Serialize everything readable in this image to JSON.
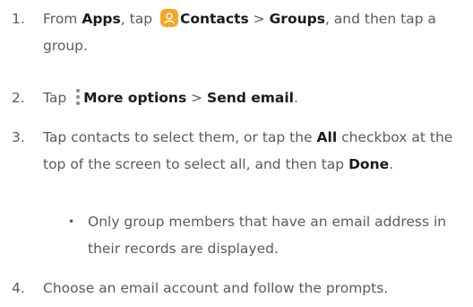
{
  "steps": [
    {
      "num": "1.",
      "from": "From ",
      "apps": "Apps",
      "tap": ", tap ",
      "icon": "contacts-icon",
      "contacts": "Contacts",
      "sep1": " > ",
      "groups": "Groups",
      "rest": ", and then tap a group."
    },
    {
      "num": "2.",
      "tap": "Tap ",
      "icon": "more-options-icon",
      "more": "More options",
      "sep": " > ",
      "send": "Send email",
      "end": "."
    },
    {
      "num": "3.",
      "pre": "Tap contacts to select them, or tap the ",
      "all": "All",
      "mid": " checkbox at the top of the screen to select all, and then tap ",
      "done": "Done",
      "end": "."
    },
    {
      "num": "4.",
      "text": "Choose an email account and follow the prompts."
    }
  ],
  "note": {
    "bullet": "•",
    "text": "Only group members that have an email address in their records are displayed."
  },
  "colors": {
    "text": "#5b5b5b",
    "bold": "#1a1a1a",
    "contacts_icon_bg": "#f5a623"
  }
}
